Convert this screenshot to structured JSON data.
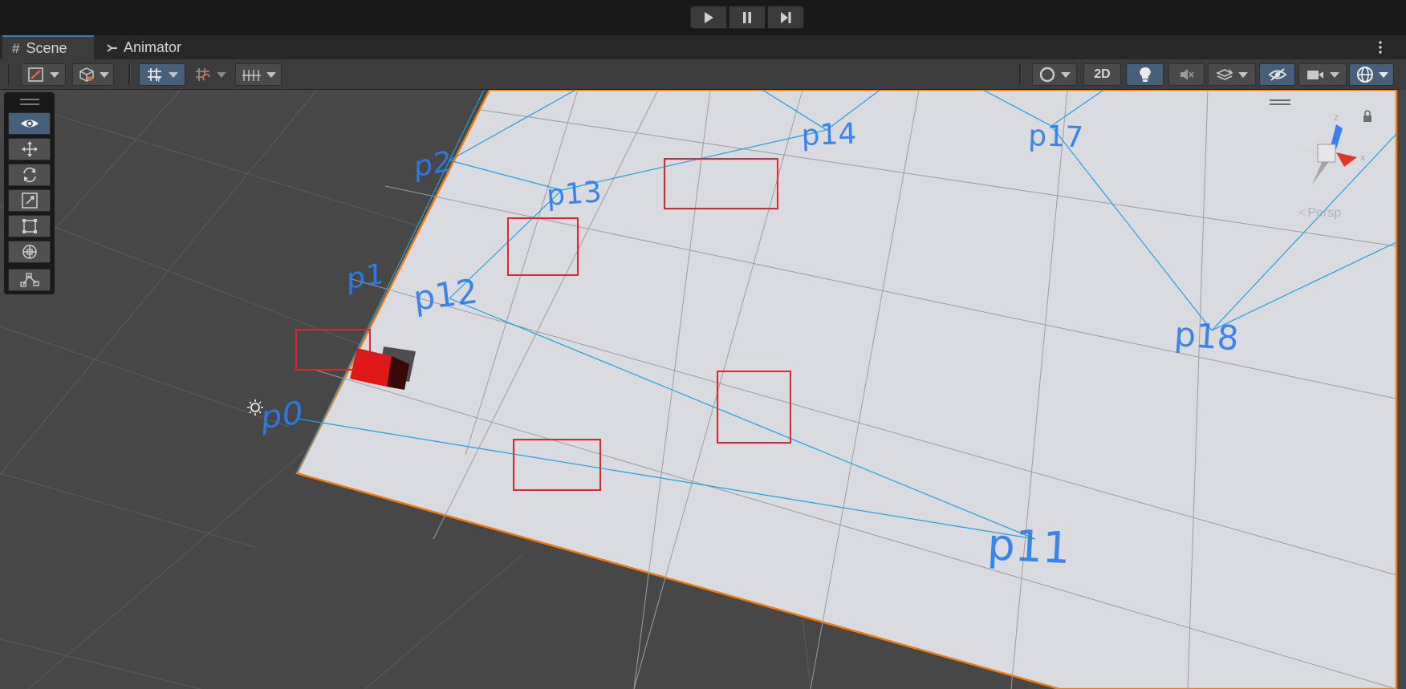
{
  "play_controls": {
    "play": "play-icon",
    "pause": "pause-icon",
    "step": "step-icon"
  },
  "tabs": [
    {
      "label": "Scene",
      "icon": "#",
      "active": true
    },
    {
      "label": "Animator",
      "icon": "animator-icon",
      "active": false
    }
  ],
  "toolbar": {
    "mode_2d_label": "2D",
    "accent_color": "#46607c"
  },
  "scene": {
    "points": [
      "p0",
      "p1",
      "p2",
      "p11",
      "p12",
      "p13",
      "p14",
      "p17",
      "p18"
    ],
    "label_color": "#2e7de9",
    "line_color": "#1ea0e6",
    "box_color": "#e0262a",
    "plane_color": "#d9dbe1",
    "outline_color": "#f07a10",
    "camera_mode": "Persp"
  }
}
